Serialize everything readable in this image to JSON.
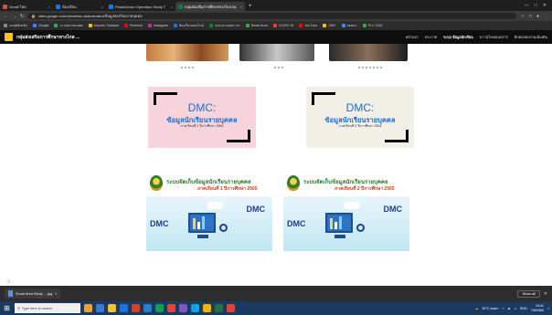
{
  "browser": {
    "tabs": [
      {
        "label": "Gmail ไทย",
        "favicon_color": "#dd4b39",
        "active": false
      },
      {
        "label": "ห้องเรียน",
        "favicon_color": "#1a73e8",
        "active": false
      },
      {
        "label": "PeachDown Operation Study T",
        "favicon_color": "#1a73e8",
        "active": false
      },
      {
        "label": "กลุ่มส่งเสริมการศึกษาทางไกล DLTV",
        "favicon_color": "#0b8043",
        "active": true
      }
    ],
    "new_tab_symbol": "+",
    "url": "sites.google.com/view/dmc-data-student/ข้อมูลนักเรียนรายบุคคล",
    "bookmarks": [
      {
        "label": "แอปพลิเคชัน",
        "color": "#888"
      },
      {
        "label": "Google",
        "color": "#4285f4"
      },
      {
        "label": "ระบบสารสนเทศ",
        "color": "#34a853"
      },
      {
        "label": "Airports Thailand",
        "color": "#fbbc05"
      },
      {
        "label": "Pinterest",
        "color": "#e60023"
      },
      {
        "label": "Instagram",
        "color": "#c13584"
      },
      {
        "label": "ห้องเรียนออนไลน์",
        "color": "#1a73e8"
      },
      {
        "label": "ระบบงานบุคลากร",
        "color": "#0b8043"
      },
      {
        "label": "Smart Area",
        "color": "#34a853"
      },
      {
        "label": "COVID-19",
        "color": "#ea4335"
      },
      {
        "label": "YouTube",
        "color": "#ff0000"
      },
      {
        "label": "DMC",
        "color": "#fbbc05"
      },
      {
        "label": "ผลสอบ",
        "color": "#4285f4"
      },
      {
        "label": "PLC 2022",
        "color": "#34a853"
      }
    ]
  },
  "site": {
    "title": "กลุ่มส่งเสริมการศึกษาทางไกล ...",
    "nav": [
      {
        "label": "หน้าแรก",
        "current": false
      },
      {
        "label": "ประกาศ",
        "current": false
      },
      {
        "label": "ระบบ ข้อมูลนักเรียน",
        "current": true
      },
      {
        "label": "ดาวน์โหลดเอกสาร",
        "current": false
      },
      {
        "label": "ติดต่อสอบถามเพิ่มเติม",
        "current": false
      }
    ]
  },
  "cards": {
    "dmc_left": {
      "title": "DMC:",
      "subtitle": "ข้อมูลนักเรียนรายบุคคล",
      "date": "ภาคเรียนที่ 1 ปีการศึกษา 2564",
      "bg": "#f7d3dc"
    },
    "dmc_right": {
      "title": "DMC:",
      "subtitle": "ข้อมูลนักเรียนรายบุคคล",
      "date": "ภาคเรียนที่ 2 ปีการศึกษา 2564",
      "bg": "#f1efe6"
    },
    "sys_left": {
      "heading": "ระบบจัดเก็บข้อมูลนักเรียนรายบุคคล",
      "term": "ภาคเรียนที่ 1 ปีการศึกษา 2565",
      "logo_text": "DMC"
    },
    "sys_right": {
      "heading": "ระบบจัดเก็บข้อมูลนักเรียนรายบุคคล",
      "term": "ภาคเรียนที่ 2 ปีการศึกษา 2565",
      "logo_text": "DMC"
    }
  },
  "download": {
    "file": "Smart Area Study ....jpg",
    "show_all": "Show all",
    "close_symbol": "✕"
  },
  "taskbar": {
    "search_placeholder": "Type here to search",
    "icons": [
      "#e8a33c",
      "#3c78d8",
      "#f2c230",
      "#1a73e8",
      "#d04423",
      "#2b7cd3",
      "#0f9d58",
      "#ea4335",
      "#7e57c2",
      "#00a4ef",
      "#f4b400",
      "#217346",
      "#db4437"
    ],
    "weather": "30°C ฝนตก",
    "lang": "ENG",
    "time": "15:41",
    "date": "7/8/2565"
  }
}
